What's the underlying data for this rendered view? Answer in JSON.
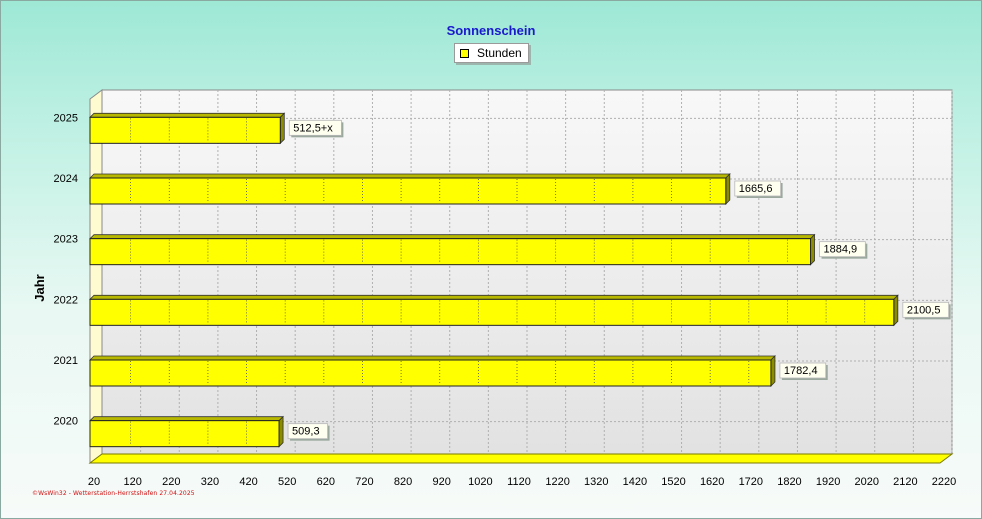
{
  "chart_data": {
    "type": "bar",
    "orientation": "horizontal",
    "title": "Sonnenschein",
    "ylabel": "Jahr",
    "xlabel": "",
    "categories": [
      "2020",
      "2021",
      "2022",
      "2023",
      "2024",
      "2025"
    ],
    "series": [
      {
        "name": "Stunden",
        "values": [
          509.3,
          1782.4,
          2100.5,
          1884.9,
          1665.6,
          512.5
        ],
        "labels": [
          "509,3",
          "1782,4",
          "2100,5",
          "1884,9",
          "1665,6",
          "512,5+x"
        ]
      }
    ],
    "xlim": [
      20,
      2220
    ],
    "xticks": [
      20,
      120,
      220,
      320,
      420,
      520,
      620,
      720,
      820,
      920,
      1020,
      1120,
      1220,
      1320,
      1420,
      1520,
      1620,
      1720,
      1820,
      1920,
      2020,
      2120,
      2220
    ],
    "grid": true,
    "legend_position": "top-center",
    "colors": {
      "bar": "#ffff00",
      "bar_dark": "#8c8c00",
      "title": "#1a1acc",
      "footer": "#d01010"
    }
  },
  "footer": "©WsWin32 - Wetterstation-Herrstshafen 27.04.2025"
}
